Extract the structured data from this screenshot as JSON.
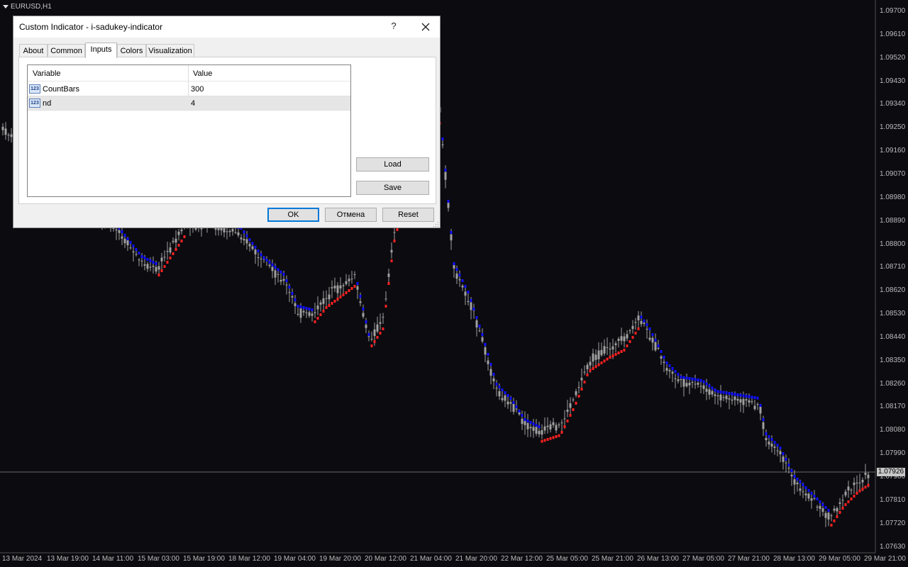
{
  "chart": {
    "symbol": "EURUSD,H1",
    "price_levels": [
      "1.09700",
      "1.09610",
      "1.09520",
      "1.09430",
      "1.09340",
      "1.09250",
      "1.09160",
      "1.09070",
      "1.08980",
      "1.08890",
      "1.08800",
      "1.08710",
      "1.08620",
      "1.08530",
      "1.08440",
      "1.08350",
      "1.08260",
      "1.08170",
      "1.08080",
      "1.07990",
      "1.07900",
      "1.07810",
      "1.07720",
      "1.07630"
    ],
    "current_price": "1.07926",
    "time_labels": [
      "13 Mar 2024",
      "13 Mar 19:00",
      "14 Mar 11:00",
      "15 Mar 03:00",
      "15 Mar 19:00",
      "18 Mar 12:00",
      "19 Mar 04:00",
      "19 Mar 20:00",
      "20 Mar 12:00",
      "21 Mar 04:00",
      "21 Mar 20:00",
      "22 Mar 12:00",
      "25 Mar 05:00",
      "25 Mar 21:00",
      "26 Mar 13:00",
      "27 Mar 05:00",
      "27 Mar 21:00",
      "28 Mar 13:00",
      "29 Mar 05:00",
      "29 Mar 21:00"
    ],
    "colors": {
      "background": "#0b0b10",
      "candles": "#a0a0a0",
      "up_dots": "#ff2020",
      "down_dots": "#1010ff",
      "axis_text": "#bdbdbd"
    }
  },
  "dialog": {
    "title": "Custom Indicator - i-sadukey-indicator",
    "help_label": "?",
    "tabs": [
      {
        "label": "About"
      },
      {
        "label": "Common"
      },
      {
        "label": "Inputs"
      },
      {
        "label": "Colors"
      },
      {
        "label": "Visualization"
      }
    ],
    "active_tab": "Inputs",
    "grid": {
      "headers": {
        "variable": "Variable",
        "value": "Value"
      },
      "rows": [
        {
          "icon": "123",
          "name": "CountBars",
          "value": "300"
        },
        {
          "icon": "123",
          "name": "nd",
          "value": "4"
        }
      ]
    },
    "buttons": {
      "load": "Load",
      "save": "Save",
      "ok": "OK",
      "cancel": "Отмена",
      "reset": "Reset"
    }
  }
}
